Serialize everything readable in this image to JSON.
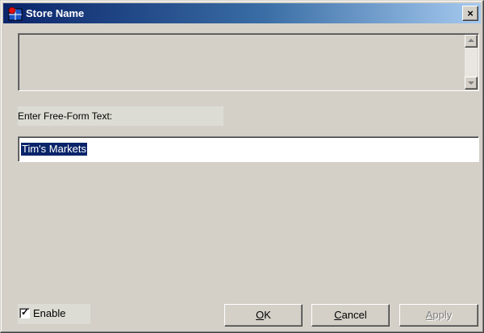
{
  "window": {
    "title": "Store Name",
    "close_label": "×"
  },
  "form": {
    "prompt_label": "Enter Free-Form Text:",
    "text_value": "Tim's Markets"
  },
  "enable": {
    "label": "Enable",
    "checked": true,
    "mark": "✓"
  },
  "buttons": {
    "ok": {
      "mnemonic": "O",
      "rest": "K"
    },
    "cancel": {
      "mnemonic": "C",
      "rest": "ancel"
    },
    "apply": {
      "mnemonic": "A",
      "rest": "pply"
    }
  },
  "colors": {
    "title_gradient_start": "#0a246a",
    "title_gradient_end": "#a6caf0",
    "dialog_face": "#d4d0c8",
    "selection": "#0a246a"
  },
  "icons": {
    "app_icon": "app-grid-icon",
    "close": "close-icon",
    "scroll_up": "scroll-up-arrow-icon",
    "scroll_down": "scroll-down-arrow-icon"
  }
}
